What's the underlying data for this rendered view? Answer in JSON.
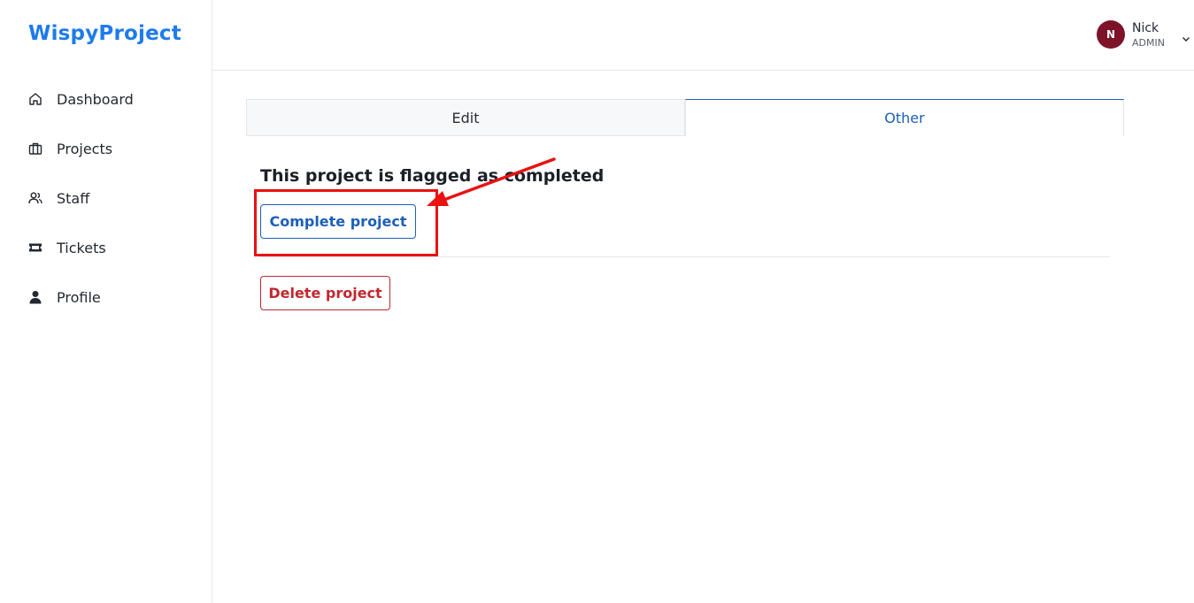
{
  "app": {
    "brand": "WispyProject",
    "brand_color": "#1e7bea"
  },
  "sidebar": {
    "items": [
      {
        "label": "Dashboard",
        "icon": "home-icon"
      },
      {
        "label": "Projects",
        "icon": "briefcase-icon"
      },
      {
        "label": "Staff",
        "icon": "users-icon"
      },
      {
        "label": "Tickets",
        "icon": "ticket-icon"
      },
      {
        "label": "Profile",
        "icon": "user-icon"
      }
    ]
  },
  "user": {
    "initial": "N",
    "name": "Nick",
    "role": "ADMIN",
    "avatar_color": "#7d1329"
  },
  "tabs": [
    {
      "label": "Edit",
      "active": false
    },
    {
      "label": "Other",
      "active": true
    }
  ],
  "content": {
    "heading": "This project is flagged as completed",
    "complete_button": "Complete project",
    "delete_button": "Delete project"
  },
  "colors": {
    "primary": "#1d5fb8",
    "danger": "#c0282e",
    "annotation": "#ea1111"
  }
}
